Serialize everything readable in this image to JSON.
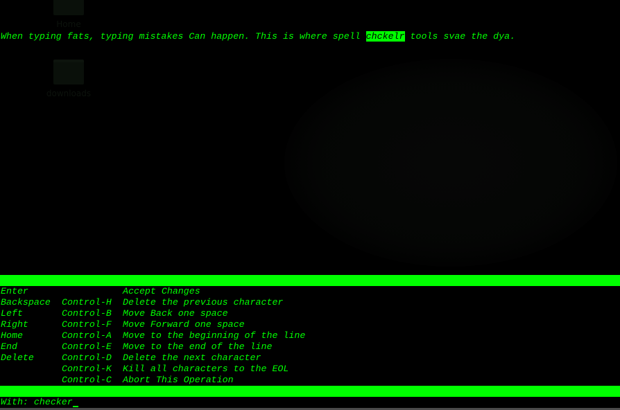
{
  "desktop": {
    "icons": [
      {
        "label": "Home"
      },
      {
        "label": "downloads"
      }
    ]
  },
  "editor": {
    "text_before": "When typing fats, typing mistakes Can happen. This is where spell ",
    "highlighted_word": "chckelr",
    "text_after": " tools svae the dya."
  },
  "help": {
    "rows": [
      {
        "key": "Enter",
        "ctrl": "",
        "action": "Accept Changes"
      },
      {
        "key": "Backspace",
        "ctrl": "Control-H",
        "action": "Delete the previous character"
      },
      {
        "key": "Left",
        "ctrl": "Control-B",
        "action": "Move Back one space"
      },
      {
        "key": "Right",
        "ctrl": "Control-F",
        "action": "Move Forward one space"
      },
      {
        "key": "Home",
        "ctrl": "Control-A",
        "action": "Move to the beginning of the line"
      },
      {
        "key": "End",
        "ctrl": "Control-E",
        "action": "Move to the end of the line"
      },
      {
        "key": "Delete",
        "ctrl": "Control-D",
        "action": "Delete the next character"
      },
      {
        "key": "",
        "ctrl": "Control-K",
        "action": "Kill all characters to the EOL"
      },
      {
        "key": "",
        "ctrl": "Control-C",
        "action": "Abort This Operation"
      }
    ]
  },
  "prompt": {
    "label": "With: ",
    "value": "checker"
  },
  "colors": {
    "foreground": "#00ff00",
    "background": "#000000",
    "highlight_text": "#000000"
  }
}
